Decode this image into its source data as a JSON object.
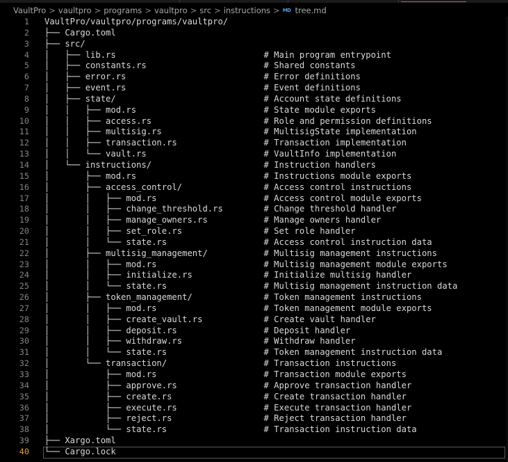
{
  "breadcrumb": {
    "items": [
      "VaultPro",
      "vaultpro",
      "programs",
      "vaultpro",
      "src",
      "instructions"
    ],
    "separator": ">",
    "file_icon": "MD",
    "file_name": "tree.md"
  },
  "editor": {
    "current_line": 40,
    "lines": [
      "VaultPro/vaultpro/programs/vaultpro/",
      "├── Cargo.toml",
      "├── src/",
      "│   ├── lib.rs                             # Main program entrypoint",
      "│   ├── constants.rs                       # Shared constants",
      "│   ├── error.rs                           # Error definitions",
      "│   ├── event.rs                           # Event definitions",
      "│   ├── state/                             # Account state definitions",
      "│   │   ├── mod.rs                         # State module exports",
      "│   │   ├── access.rs                      # Role and permission definitions",
      "│   │   ├── multisig.rs                    # MultisigState implementation",
      "│   │   ├── transaction.rs                 # Transaction implementation",
      "│   │   └── vault.rs                       # VaultInfo implementation",
      "│   └── instructions/                      # Instruction handlers",
      "│       ├── mod.rs                         # Instructions module exports",
      "│       ├── access_control/                # Access control instructions",
      "│       │   ├── mod.rs                     # Access control module exports",
      "│       │   ├── change_threshold.rs        # Change threshold handler",
      "│       │   ├── manage_owners.rs           # Manage owners handler",
      "│       │   ├── set_role.rs                # Set role handler",
      "│       │   └── state.rs                   # Access control instruction data",
      "│       ├── multisig_management/           # Multisig management instructions",
      "│       │   ├── mod.rs                     # Multisig management module exports",
      "│       │   ├── initialize.rs              # Initialize multisig handler",
      "│       │   └── state.rs                   # Multisig management instruction data",
      "│       ├── token_management/              # Token management instructions",
      "│       │   ├── mod.rs                     # Token management module exports",
      "│       │   ├── create_vault.rs            # Create vault handler",
      "│       │   ├── deposit.rs                 # Deposit handler",
      "│       │   ├── withdraw.rs                # Withdraw handler",
      "│       │   └── state.rs                   # Token management instruction data",
      "│       └── transaction/                   # Transaction instructions",
      "│           ├── mod.rs                     # Transaction module exports",
      "│           ├── approve.rs                 # Approve transaction handler",
      "│           ├── create.rs                  # Create transaction handler",
      "│           ├── execute.rs                 # Execute transaction handler",
      "│           ├── reject.rs                  # Reject transaction handler",
      "│           └── state.rs                   # Transaction instruction data",
      "├── Xargo.toml",
      "└── Cargo.lock"
    ]
  },
  "colors": {
    "background": "#000000",
    "text": "#d9d9d9",
    "line_number": "#858585",
    "current_line_number": "#e8a23a",
    "md_icon": "#5b9bd5"
  }
}
